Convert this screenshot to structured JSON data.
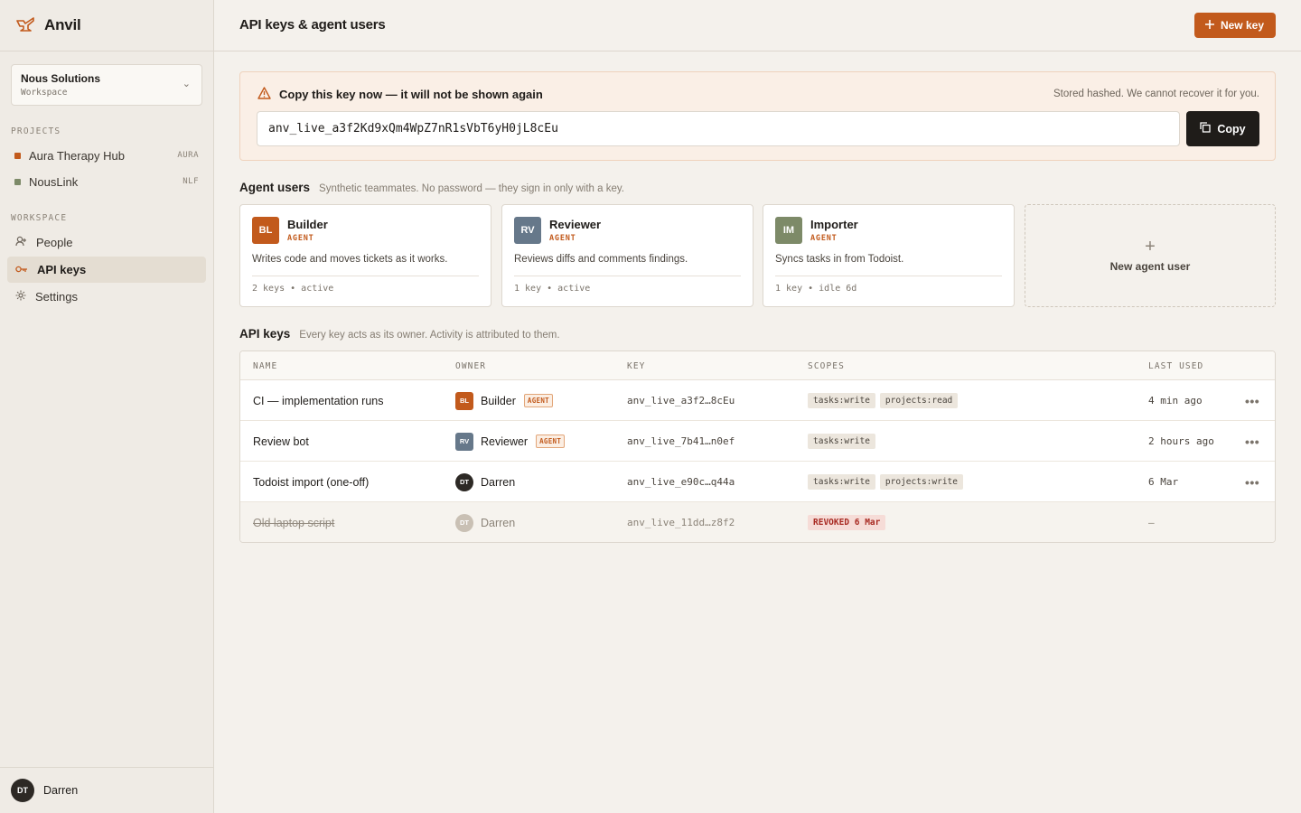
{
  "app": {
    "name": "Anvil",
    "accent": "#c25a1c"
  },
  "workspace": {
    "name": "Nous Solutions",
    "sub": "Workspace"
  },
  "sidebar": {
    "projects_label": "PROJECTS",
    "projects": [
      {
        "name": "Aura Therapy Hub",
        "code": "AURA",
        "color": "#c25a1c"
      },
      {
        "name": "NousLink",
        "code": "NLF",
        "color": "#7d8a68"
      }
    ],
    "workspace_label": "WORKSPACE",
    "nav": [
      {
        "label": "People",
        "icon": "people-icon"
      },
      {
        "label": "API keys",
        "icon": "key-icon",
        "active": true
      },
      {
        "label": "Settings",
        "icon": "gear-icon"
      }
    ],
    "user": {
      "initials": "DT",
      "name": "Darren"
    }
  },
  "header": {
    "title": "API keys & agent users",
    "new_key_label": "New key"
  },
  "alert": {
    "title": "Copy this key now — it will not be shown again",
    "note": "Stored hashed. We cannot recover it for you.",
    "key_value": "anv_live_a3f2Kd9xQm4WpZ7nR1sVbT6yH0jL8cEu",
    "copy_label": "Copy"
  },
  "agents": {
    "title": "Agent users",
    "description": "Synthetic teammates. No password — they sign in only with a key.",
    "items": [
      {
        "initials": "BL",
        "name": "Builder",
        "tag": "AGENT",
        "desc": "Writes code and moves tickets as it works.",
        "meta": "2 keys • active",
        "color": "#c25a1c"
      },
      {
        "initials": "RV",
        "name": "Reviewer",
        "tag": "AGENT",
        "desc": "Reviews diffs and comments findings.",
        "meta": "1 key • active",
        "color": "#66788a"
      },
      {
        "initials": "IM",
        "name": "Importer",
        "tag": "AGENT",
        "desc": "Syncs tasks in from Todoist.",
        "meta": "1 key • idle 6d",
        "color": "#7d8a68"
      }
    ],
    "new_label": "New agent user"
  },
  "keys": {
    "title": "API keys",
    "description": "Every key acts as its owner. Activity is attributed to them.",
    "columns": [
      "NAME",
      "OWNER",
      "KEY",
      "SCOPES",
      "LAST USED"
    ],
    "rows": [
      {
        "name": "CI — implementation runs",
        "owner": "Builder",
        "owner_initials": "BL",
        "owner_color": "#c25a1c",
        "agent": "AGENT",
        "key": "anv_live_a3f2…8cEu",
        "scopes": [
          "tasks:write",
          "projects:read"
        ],
        "last_used": "4 min ago",
        "more": "•••"
      },
      {
        "name": "Review bot",
        "owner": "Reviewer",
        "owner_initials": "RV",
        "owner_color": "#66788a",
        "agent": "AGENT",
        "key": "anv_live_7b41…n0ef",
        "scopes": [
          "tasks:write"
        ],
        "last_used": "2 hours ago",
        "more": "•••"
      },
      {
        "name": "Todoist import (one-off)",
        "owner": "Darren",
        "owner_initials": "DT",
        "owner_color": "#2d2925",
        "key": "anv_live_e90c…q44a",
        "scopes": [
          "tasks:write",
          "projects:write"
        ],
        "last_used": "6 Mar",
        "more": "•••"
      },
      {
        "name": "Old laptop script",
        "owner": "Darren",
        "owner_initials": "DT",
        "owner_color": "#c9c0b4",
        "key": "anv_live_11dd…z8f2",
        "revoked": "REVOKED 6 Mar",
        "last_used": "—"
      }
    ]
  }
}
